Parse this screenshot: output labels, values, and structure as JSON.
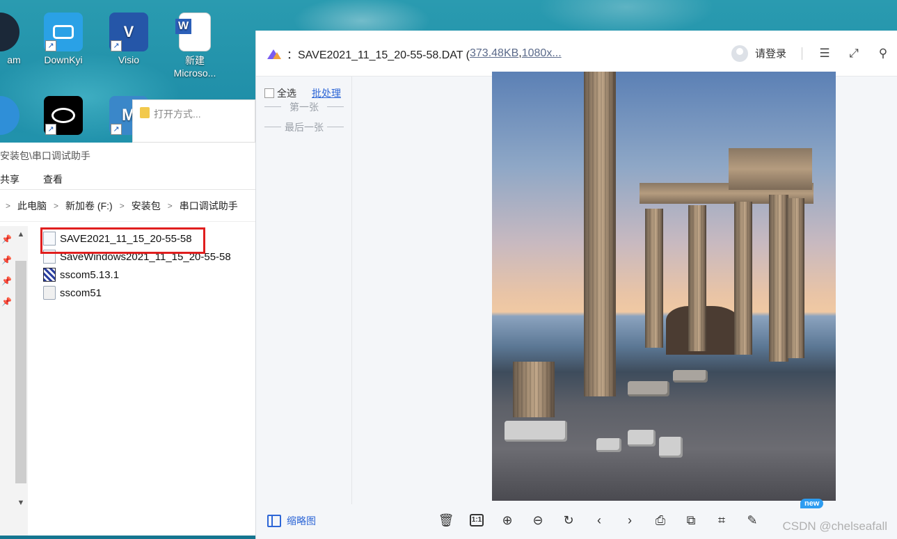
{
  "desktop": {
    "icons": [
      {
        "label": "am"
      },
      {
        "label": "DownKyi"
      },
      {
        "label": "Visio"
      },
      {
        "label": "新建\nMicroso..."
      }
    ]
  },
  "openwith": {
    "title": "打开方式..."
  },
  "explorer": {
    "path": "安装包\\串口调试助手",
    "ribbon": [
      "共享",
      "查看"
    ],
    "breadcrumb": [
      "此电脑",
      "新加卷 (F:)",
      "安装包",
      "串口调试助手"
    ],
    "files": [
      {
        "name": "SAVE2021_11_15_20-55-58",
        "icon": "video-file-icon"
      },
      {
        "name": "SaveWindows2021_11_15_20-55-58",
        "icon": "text-file-icon"
      },
      {
        "name": "sscom5.13.1",
        "icon": "app-icon"
      },
      {
        "name": "sscom51",
        "icon": "settings-file-icon"
      }
    ]
  },
  "viewer": {
    "file_name": "：SAVE2021_11_15_20-55-58.DAT (",
    "file_size": "373.48KB",
    "sep": " , ",
    "dimensions": "1080x...",
    "login": "请登录",
    "select_all": "全选",
    "batch": "批处理",
    "first": "第一张",
    "last": "最后一张",
    "thumbnails": "缩略图",
    "new_badge": "new",
    "one_to_one": "1:1"
  },
  "watermark": "CSDN @chelseafall",
  "colors": {
    "accent": "#2d66d6",
    "highlight": "#e01e1e"
  }
}
